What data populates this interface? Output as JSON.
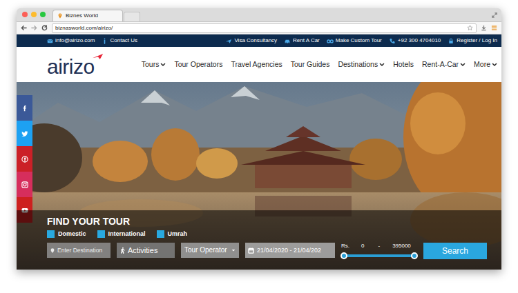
{
  "browser": {
    "tab_title": "Biznes World",
    "url": "biznasworld.com/airizo/"
  },
  "top_bar": {
    "left": [
      {
        "label": "info@airizo.com"
      },
      {
        "label": "Contact Us"
      }
    ],
    "right": [
      {
        "label": "Visa Consultancy"
      },
      {
        "label": "Rent A Car"
      },
      {
        "label": "Make Custom Tour"
      },
      {
        "label": "+92 300 4704010"
      },
      {
        "label": "Register / Log In"
      }
    ]
  },
  "logo": "airizo",
  "nav": [
    {
      "label": "Tours",
      "dropdown": true
    },
    {
      "label": "Tour Operators",
      "dropdown": false
    },
    {
      "label": "Travel Agencies",
      "dropdown": false
    },
    {
      "label": "Tour Guides",
      "dropdown": false
    },
    {
      "label": "Destinations",
      "dropdown": true
    },
    {
      "label": "Hotels",
      "dropdown": false
    },
    {
      "label": "Rent-A-Car",
      "dropdown": true
    },
    {
      "label": "More",
      "dropdown": true
    }
  ],
  "social": [
    {
      "color": "#3b5998"
    },
    {
      "color": "#1da1f2"
    },
    {
      "color": "#cb2027"
    },
    {
      "color": "#d62e5c"
    },
    {
      "color": "#cd201f"
    }
  ],
  "search": {
    "title": "FIND YOUR TOUR",
    "types": [
      {
        "label": "Domestic"
      },
      {
        "label": "International"
      },
      {
        "label": "Umrah"
      }
    ],
    "destination": {
      "placeholder": "Enter Destination"
    },
    "activities": "Activities",
    "tour_operator": "Tour Operator",
    "dates": "21/04/2020 - 21/04/202",
    "price": {
      "currency": "Rs.",
      "min": "0",
      "separator": "-",
      "max": "395000",
      "level": 1
    },
    "button": "Search"
  }
}
